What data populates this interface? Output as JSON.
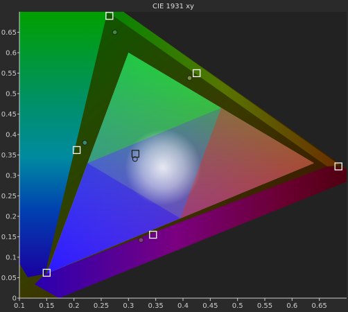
{
  "chart_data": {
    "type": "scatter",
    "title": "CIE 1931 xy",
    "xlim": [
      0.1,
      0.7
    ],
    "ylim": [
      0,
      0.7
    ],
    "x_ticks": [
      "0.1",
      "0.15",
      "0.2",
      "0.25",
      "0.3",
      "0.35",
      "0.4",
      "0.45",
      "0.5",
      "0.55",
      "0.6",
      "0.65"
    ],
    "y_ticks": [
      "0",
      "0.05",
      "0.1",
      "0.15",
      "0.2",
      "0.25",
      "0.3",
      "0.35",
      "0.4",
      "0.45",
      "0.5",
      "0.55",
      "0.6",
      "0.65"
    ],
    "grid": false,
    "gamut_triangle": [
      {
        "x": 0.64,
        "y": 0.33
      },
      {
        "x": 0.3,
        "y": 0.6
      },
      {
        "x": 0.15,
        "y": 0.06
      }
    ],
    "target_points": [
      {
        "x": 0.265,
        "y": 0.69
      },
      {
        "x": 0.425,
        "y": 0.55
      },
      {
        "x": 0.685,
        "y": 0.322
      },
      {
        "x": 0.205,
        "y": 0.362
      },
      {
        "x": 0.3127,
        "y": 0.3529
      },
      {
        "x": 0.345,
        "y": 0.155
      },
      {
        "x": 0.15,
        "y": 0.062
      }
    ],
    "measured_points": [
      {
        "x": 0.275,
        "y": 0.65,
        "color": "#3a8c3a"
      },
      {
        "x": 0.412,
        "y": 0.538,
        "color": "#7a8a3a"
      },
      {
        "x": 0.22,
        "y": 0.38,
        "color": "#3a8a6a"
      },
      {
        "x": 0.312,
        "y": 0.34,
        "color": "#ffffff"
      },
      {
        "x": 0.323,
        "y": 0.142,
        "color": "#8a3a8a"
      }
    ],
    "colors": {
      "background": "#2a2a2a",
      "plot_background": "#222222",
      "axis": "#d0d0d0",
      "marker_stroke": "#ffffff"
    }
  }
}
